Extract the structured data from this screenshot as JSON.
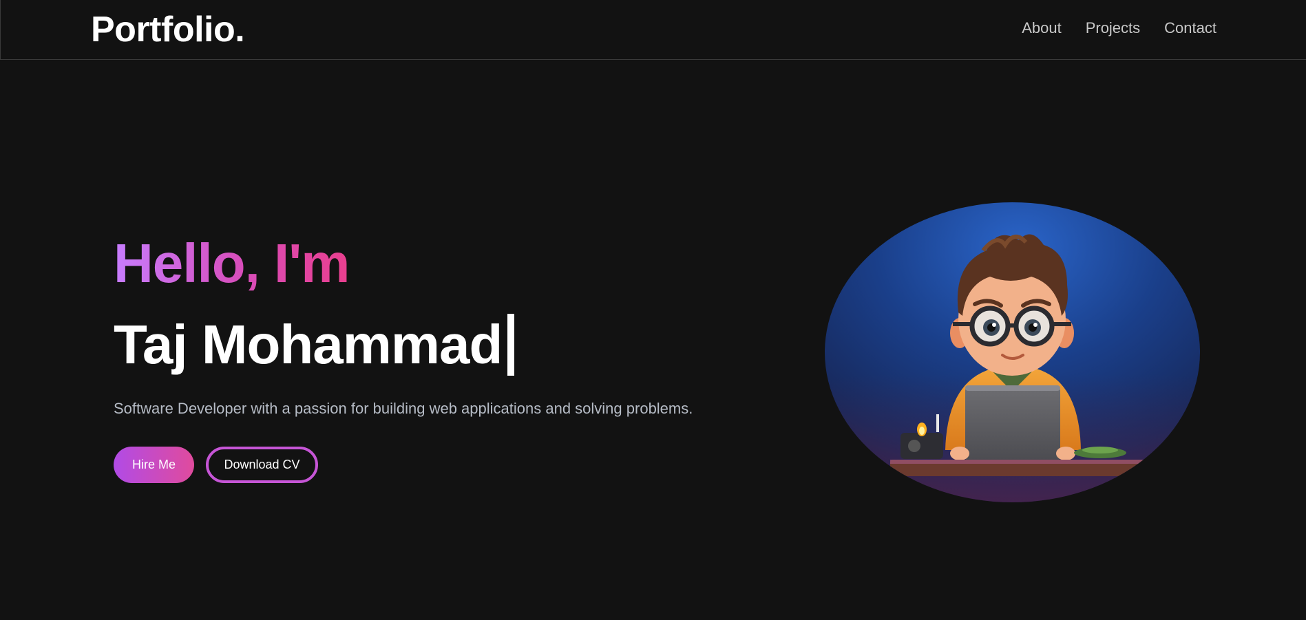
{
  "brand": {
    "logo_text": "Portfolio."
  },
  "nav": {
    "items": [
      {
        "label": "About"
      },
      {
        "label": "Projects"
      },
      {
        "label": "Contact"
      }
    ]
  },
  "hero": {
    "greeting": "Hello, I'm",
    "name": "Taj Mohammad",
    "tagline": "Software Developer with a passion for building web applications and solving problems.",
    "primary_button": "Hire Me",
    "secondary_button": "Download CV"
  },
  "colors": {
    "background": "#121212",
    "accent_purple": "#c77dff",
    "accent_pink": "#e93f8e",
    "text_muted": "#b6bcc6"
  },
  "icons": {
    "avatar": "developer-avatar-illustration"
  }
}
